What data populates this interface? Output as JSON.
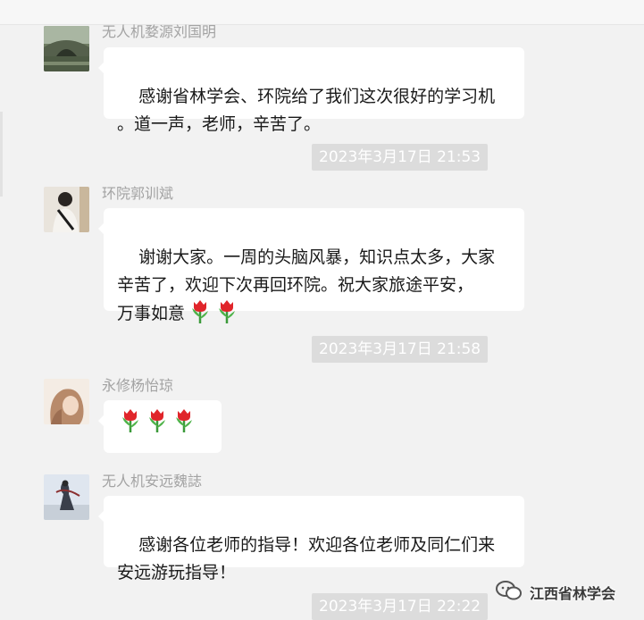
{
  "messages": [
    {
      "sender": "无人机婺源刘国明",
      "text": "感谢省林学会、环院给了我们这次很好的学习机\n。道一声，老师，辛苦了。",
      "avatar": "bridge-avatar"
    },
    {
      "sender": "环院郭训斌",
      "text": "谢谢大家。一周的头脑风暴，知识点太多，大家\n辛苦了，欢迎下次再回环院。祝大家旅途平安，\n万事如意",
      "emoji": [
        "tulip-emoji",
        "tulip-emoji"
      ],
      "avatar": "person-avatar"
    },
    {
      "sender": "永修杨怡琼",
      "text": "",
      "emoji": [
        "tulip-emoji",
        "tulip-emoji",
        "tulip-emoji"
      ],
      "avatar": "girl-avatar"
    },
    {
      "sender": "无人机安远魏誌",
      "text": "感谢各位老师的指导！欢迎各位老师及同仁们来\n安远游玩指导！",
      "avatar": "dancer-avatar"
    }
  ],
  "timestamps": [
    "2023年3月17日 21:53",
    "2023年3月17日 21:58",
    "2023年3月17日 22:22"
  ],
  "watermark": {
    "text": "江西省林学会",
    "icon": "wechat-icon"
  },
  "colors": {
    "background": "#f2f2f2",
    "bubble": "#ffffff",
    "sender": "#a3a3a3",
    "timestamp_bg": "#dcdcdc"
  }
}
